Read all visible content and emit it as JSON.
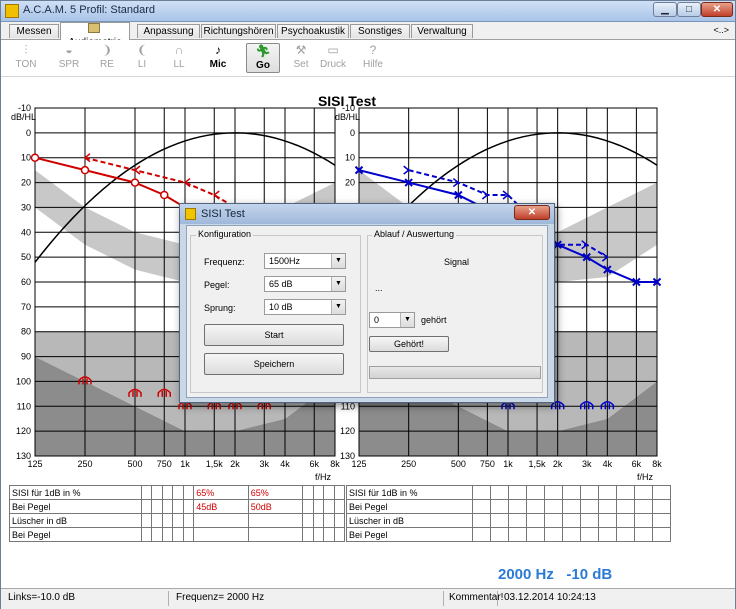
{
  "window": {
    "title": "A.C.A.M. 5  Profil: Standard",
    "controls": {
      "minimize": "▁",
      "maximize": "□",
      "close": "✕"
    }
  },
  "tabs": [
    {
      "label": "Messen"
    },
    {
      "label": "Audiometrie"
    },
    {
      "label": "Anpassung"
    },
    {
      "label": "Richtungshören"
    },
    {
      "label": "Psychoakustik"
    },
    {
      "label": "Sonstiges"
    },
    {
      "label": "Verwaltung"
    }
  ],
  "tab_more": "<..>",
  "toolbar": [
    {
      "label": "TON",
      "icon": "sliders-icon"
    },
    {
      "label": "SPR",
      "icon": "lips-icon"
    },
    {
      "label": "RE",
      "icon": "right-ear-icon"
    },
    {
      "label": "LI",
      "icon": "left-ear-icon"
    },
    {
      "label": "LL",
      "icon": "headphones-icon"
    },
    {
      "label": "Mic",
      "icon": "microphone-icon"
    },
    {
      "label": "Go",
      "icon": "run-icon"
    },
    {
      "label": "Set",
      "icon": "tools-icon"
    },
    {
      "label": "Druck",
      "icon": "printer-icon"
    },
    {
      "label": "Hilfe",
      "icon": "help-icon"
    }
  ],
  "chart_data": {
    "type": "line",
    "title": "SISI Test",
    "ylabel": "dB/HL",
    "xlabel": "f/Hz",
    "y_ticks": [
      -10,
      0,
      10,
      20,
      30,
      40,
      50,
      60,
      70,
      80,
      90,
      100,
      110,
      120,
      130
    ],
    "ylim": [
      -10,
      130
    ],
    "x_ticks": [
      "125",
      "250",
      "500",
      "750",
      "1k",
      "1,5k",
      "2k",
      "3k",
      "4k",
      "6k",
      "8k"
    ],
    "x_scale": "log",
    "grid": true,
    "colors": {
      "right": "#d00000",
      "left": "#0000cc",
      "reference_curve": "#000000",
      "shading_light": "#c8c8c8",
      "shading_dark": "#8c8c8c"
    },
    "panels": [
      {
        "side": "right",
        "series": [
          {
            "style": "solid-circle",
            "x": [
              125,
              250,
              500,
              750,
              1000
            ],
            "y": [
              10,
              15,
              20,
              25,
              30
            ]
          },
          {
            "style": "dashed-arrow",
            "x": [
              250,
              500,
              1000,
              1500,
              2000
            ],
            "y": [
              10,
              15,
              20,
              25,
              30
            ]
          },
          {
            "style": "masking-marker",
            "x": [
              250,
              500,
              750,
              1000,
              1500,
              2000,
              3000
            ],
            "y": [
              100,
              105,
              105,
              110,
              110,
              110,
              110
            ]
          }
        ]
      },
      {
        "side": "left",
        "series": [
          {
            "style": "solid-cross",
            "x": [
              125,
              250,
              500,
              2000,
              3000,
              4000,
              6000,
              8000
            ],
            "y": [
              15,
              20,
              25,
              45,
              50,
              55,
              60,
              60
            ]
          },
          {
            "style": "dashed-arrow",
            "x": [
              250,
              500,
              750,
              1000,
              2000,
              3000,
              4000
            ],
            "y": [
              15,
              20,
              25,
              25,
              45,
              45,
              50
            ]
          },
          {
            "style": "masking-marker",
            "x": [
              1000,
              2000,
              3000,
              4000
            ],
            "y": [
              110,
              110,
              110,
              110
            ]
          }
        ]
      }
    ]
  },
  "results_table": {
    "right": {
      "rows": [
        {
          "label": "SISI für 1dB in %",
          "cells": [
            "",
            "",
            "",
            "",
            "",
            "65%",
            "65%",
            "",
            "",
            "",
            ""
          ]
        },
        {
          "label": "Bei Pegel",
          "cells": [
            "",
            "",
            "",
            "",
            "",
            "45dB",
            "50dB",
            "",
            "",
            "",
            ""
          ]
        },
        {
          "label": "Lüscher in dB",
          "cells": [
            "",
            "",
            "",
            "",
            "",
            "",
            "",
            "",
            "",
            "",
            ""
          ]
        },
        {
          "label": "Bei Pegel",
          "cells": [
            "",
            "",
            "",
            "",
            "",
            "",
            "",
            "",
            "",
            "",
            ""
          ]
        }
      ]
    },
    "left": {
      "rows": [
        {
          "label": "SISI für 1dB in %",
          "cells": [
            "",
            "",
            "",
            "",
            "",
            "",
            "",
            "",
            "",
            "",
            ""
          ]
        },
        {
          "label": "Bei Pegel",
          "cells": [
            "",
            "",
            "",
            "",
            "",
            "",
            "",
            "",
            "",
            "",
            ""
          ]
        },
        {
          "label": "Lüscher in dB",
          "cells": [
            "",
            "",
            "",
            "",
            "",
            "",
            "",
            "",
            "",
            "",
            ""
          ]
        },
        {
          "label": "Bei Pegel",
          "cells": [
            "",
            "",
            "",
            "",
            "",
            "",
            "",
            "",
            "",
            "",
            ""
          ]
        }
      ]
    }
  },
  "status_big": {
    "frequency": "2000 Hz",
    "level": "-10 dB"
  },
  "statusbar": {
    "links": "Links=-10.0 dB",
    "frequenz": "Frequenz= 2000 Hz",
    "kommentar": "Kommentar!",
    "datetime": "03.12.2014 10:24:13"
  },
  "dialog": {
    "title": "SISI Test",
    "close_label": "✕",
    "config_group": "Konfiguration",
    "frequenz_label": "Frequenz:",
    "frequenz_value": "1500Hz",
    "pegel_label": "Pegel:",
    "pegel_value": "65 dB",
    "sprung_label": "Sprung:",
    "sprung_value": "10 dB",
    "start_button": "Start",
    "save_button": "Speichern",
    "sequence_group": "Ablauf / Auswertung",
    "signal_label": "Signal",
    "ellipsis": "...",
    "heard_count": "0",
    "heard_label": "gehört",
    "heard_button": "Gehört!",
    "progress": 0
  }
}
